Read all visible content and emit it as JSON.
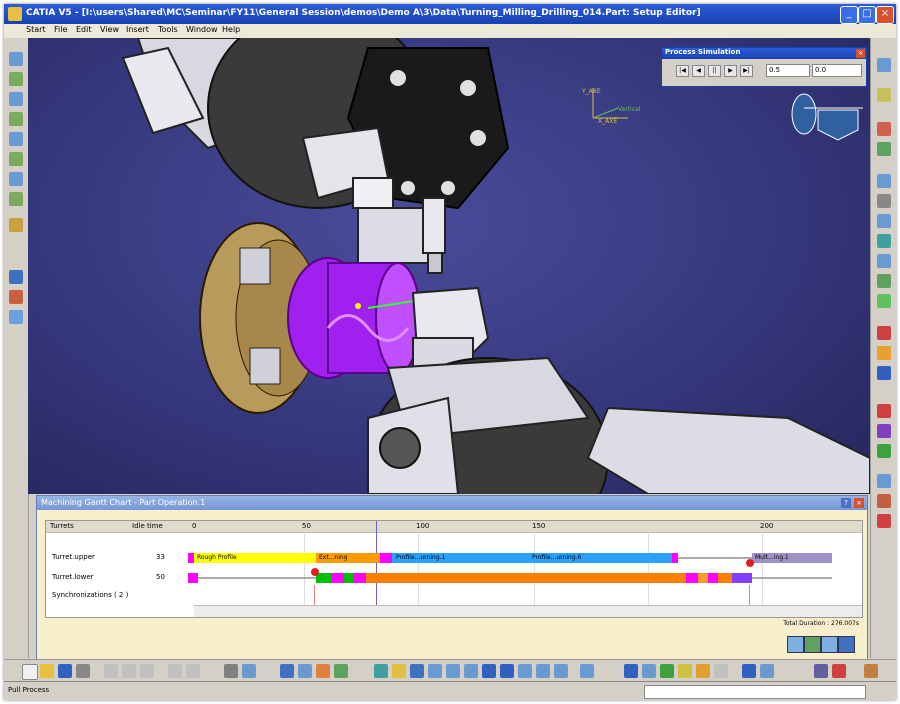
{
  "window": {
    "title": "CATIA V5 - [I:\\users\\Shared\\MC\\Seminar\\FY11\\General Session\\demos\\Demo A\\3\\Data\\Turning_Milling_Drilling_014.Part: Setup Editor]",
    "controls": [
      "_",
      "□",
      "×"
    ]
  },
  "menu": [
    "Start",
    "File",
    "Edit",
    "View",
    "Insert",
    "Tools",
    "Window",
    "Help"
  ],
  "process_simulation": {
    "title": "Process Simulation",
    "buttons": [
      "|◀",
      "◀",
      "||",
      "▶",
      "▶|"
    ],
    "speed_value": "0.5",
    "time_value": "0.0"
  },
  "viewport": {
    "axis_labels": [
      "Y_AXE",
      "X_AXE",
      "Vertical"
    ]
  },
  "gantt": {
    "title": "Machining Gantt Chart - Part Operation.1",
    "header_buttons": [
      "?",
      "×"
    ],
    "columns": {
      "turrets": "Turrets",
      "idle_time": "Idle time"
    },
    "scale_ticks": [
      "0",
      "50",
      "100",
      "150",
      "200"
    ],
    "rows": [
      {
        "name": "Turret.upper",
        "idle": "33"
      },
      {
        "name": "Turret.lower",
        "idle": "50"
      },
      {
        "name": "Synchronizations ( 2 )",
        "idle": ""
      }
    ],
    "bar_labels": {
      "rough": "Rough Profile",
      "ext": "Ext...ning",
      "profile1": "Profile...urning.1",
      "profile2": "Profile...urning.6",
      "multi": "Mult...ing.1"
    },
    "total_duration": "Total Duration : 276.007s"
  },
  "status": {
    "text": "Pull Process"
  },
  "colors": {
    "title_bar": "#1f4fc4",
    "viewport_bg": "#3a3c84",
    "gantt_bg": "#f7efcc",
    "part_purple": "#a020f0",
    "chuck_gold": "#b89a5a",
    "bar_yellow": "#ffff00",
    "bar_blue": "#2aa0ff",
    "bar_orange": "#ff7f00",
    "bar_magenta": "#ff00ff",
    "bar_green": "#00c000",
    "bar_lilac": "#a090c8"
  }
}
